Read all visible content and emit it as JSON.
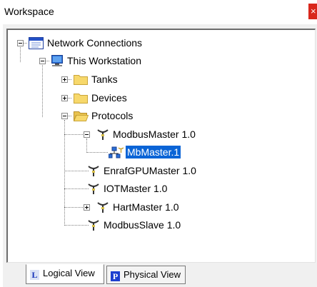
{
  "window": {
    "title": "Workspace",
    "close_glyph": "×"
  },
  "tree": {
    "network_connections": "Network Connections",
    "this_workstation": "This Workstation",
    "tanks": "Tanks",
    "devices": "Devices",
    "protocols": "Protocols",
    "modbus_master": "ModbusMaster 1.0",
    "mb_master": "MbMaster.1",
    "enraf_gpu_master": "EnrafGPUMaster 1.0",
    "iot_master": "IOTMaster 1.0",
    "hart_master": "HartMaster 1.0",
    "modbus_slave": "ModbusSlave 1.0"
  },
  "tabs": {
    "logical": {
      "letter": "L",
      "label": "Logical View"
    },
    "physical": {
      "letter": "P",
      "label": "Physical View"
    }
  },
  "colors": {
    "selection": "#0a64d6",
    "close": "#d9271c",
    "folder": "#f7d86b"
  }
}
